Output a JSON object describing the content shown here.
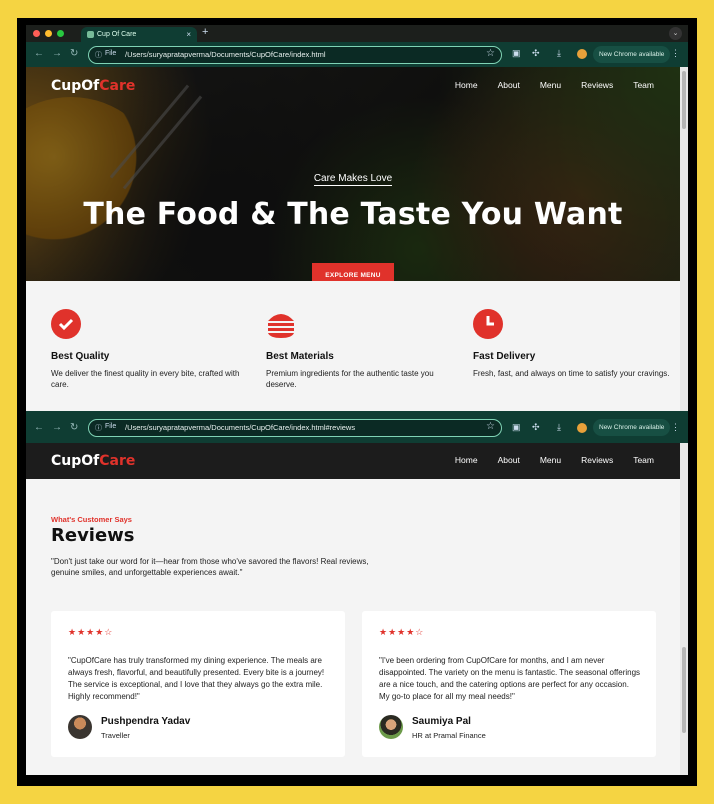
{
  "browser": {
    "tab_title": "Cup Of Care",
    "tab_close": "×",
    "new_tab": "+",
    "file_chip": "File",
    "url_top": "/Users/suryapratapverma/Documents/CupOfCare/index.html",
    "url_bottom": "/Users/suryapratapverma/Documents/CupOfCare/index.html#reviews",
    "new_chrome": "New Chrome available",
    "icons": [
      "back-icon",
      "forward-icon",
      "reload-icon",
      "info-icon",
      "star-icon",
      "extensions-icon",
      "download-icon",
      "kebab-icon"
    ]
  },
  "site": {
    "logo_part1": "CupOf",
    "logo_part2": "Care",
    "nav": [
      "Home",
      "About",
      "Menu",
      "Reviews",
      "Team"
    ]
  },
  "hero": {
    "tagline": "Care Makes Love",
    "title": "The Food & The Taste You Want",
    "button": "EXPLORE MENU"
  },
  "features": [
    {
      "icon": "badge-check-icon",
      "title": "Best Quality",
      "desc": "We deliver the finest quality in every bite, crafted with care."
    },
    {
      "icon": "burger-icon",
      "title": "Best Materials",
      "desc": "Premium ingredients for the authentic taste you deserve."
    },
    {
      "icon": "clock-icon",
      "title": "Fast Delivery",
      "desc": "Fresh, fast, and always on time to satisfy your cravings."
    }
  ],
  "reviews": {
    "eyebrow": "What's Customer Says",
    "title": "Reviews",
    "intro": "\"Don't just take our word for it—hear from those who've savored the flavors! Real reviews, genuine smiles, and unforgettable experiences await.\"",
    "items": [
      {
        "stars": "★★★★☆",
        "quote": "\"CupOfCare has truly transformed my dining experience. The meals are always fresh, flavorful, and beautifully presented. Every bite is a journey! The service is exceptional, and I love that they always go the extra mile. Highly recommend!\"",
        "name": "Pushpendra Yadav",
        "role": "Traveller"
      },
      {
        "stars": "★★★★☆",
        "quote": "\"I've been ordering from CupOfCare for months, and I am never disappointed. The variety on the menu is fantastic. The seasonal offerings are a nice touch, and the catering options are perfect for any occasion. My go-to place for all my meal needs!\"",
        "name": "Saumiya Pal",
        "role": "HR at Pramal Finance"
      }
    ]
  },
  "colors": {
    "accent": "#e0322b",
    "chrome": "#0f3d33",
    "frame": "#f5d442"
  }
}
